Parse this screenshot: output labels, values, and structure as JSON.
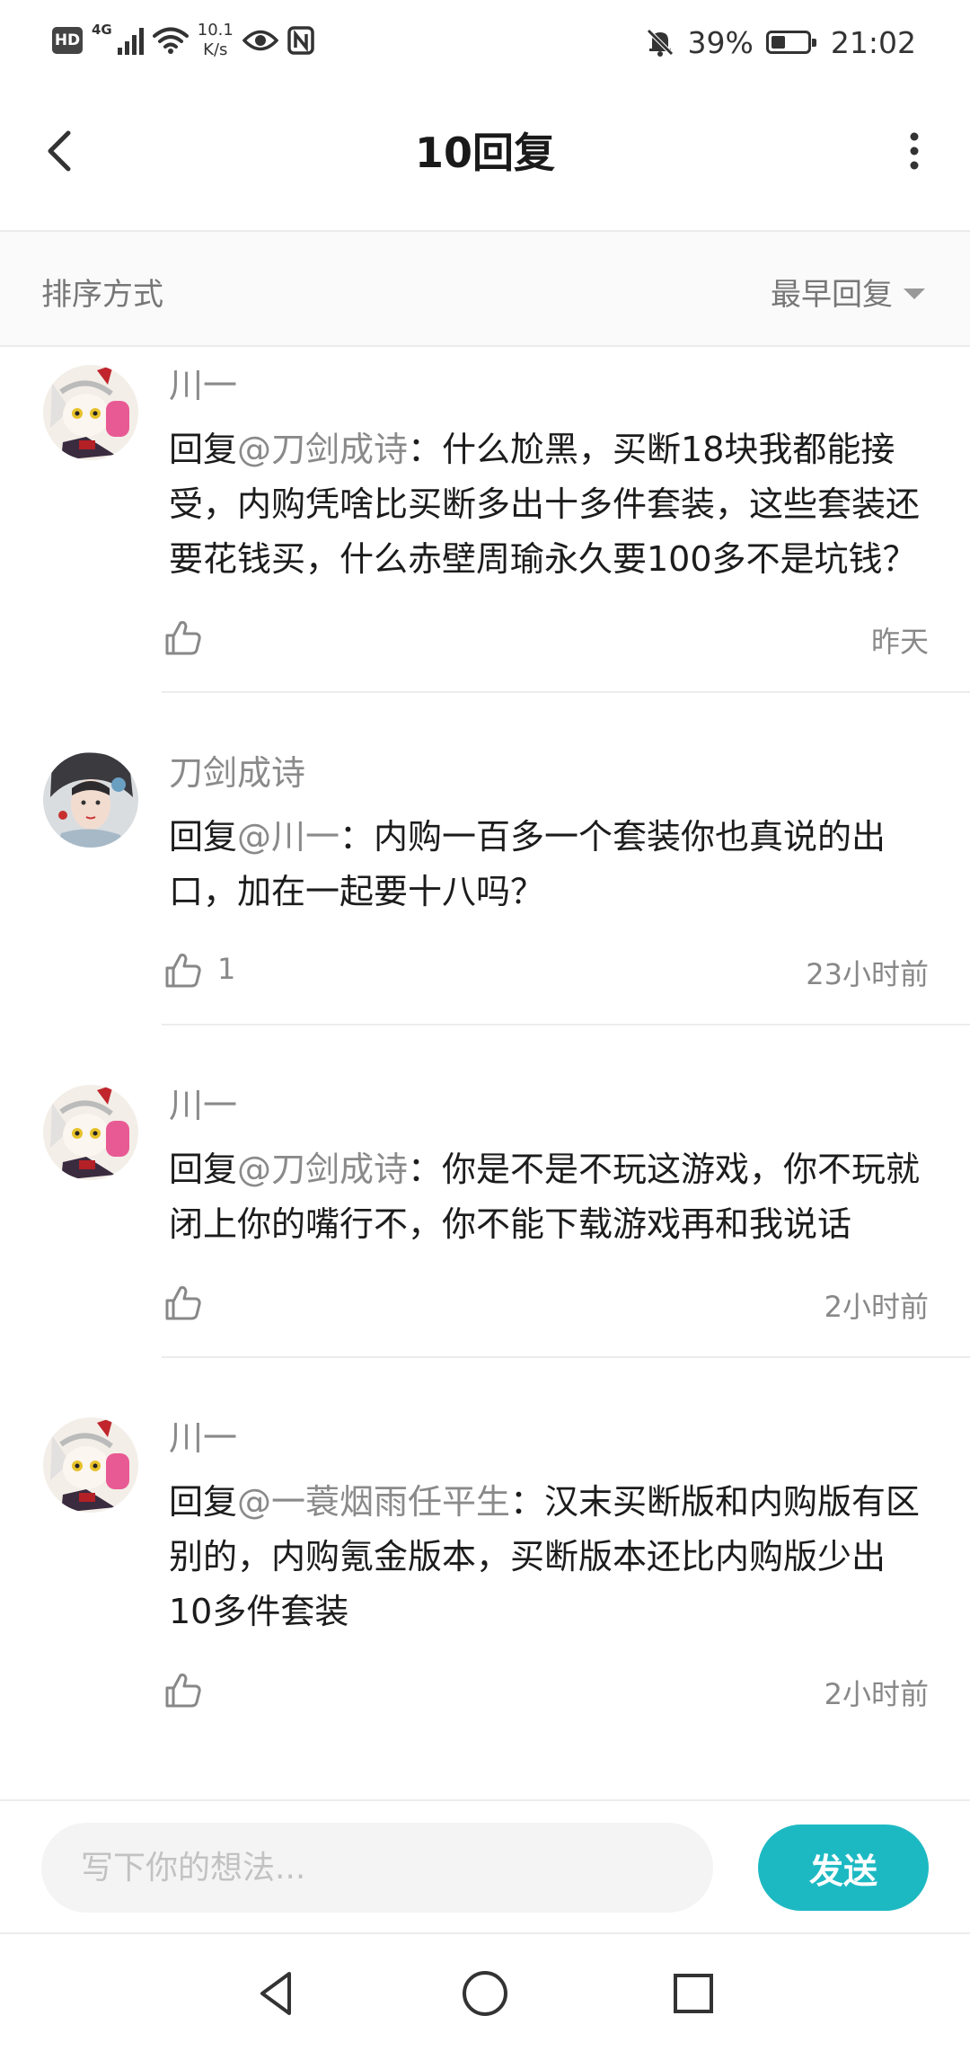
{
  "status_bar": {
    "hd": "HD",
    "network": "4G",
    "speed_value": "10.1",
    "speed_unit": "K/s",
    "battery_text": "39%",
    "battery_level": 0.39,
    "time": "21:02"
  },
  "header": {
    "title": "10回复"
  },
  "sort": {
    "label": "排序方式",
    "selected": "最早回复"
  },
  "comments": [
    {
      "user": "川一",
      "reply_prefix": "回复",
      "mention": "@刀剑成诗",
      "text": "：什么尬黑，买断18块我都能接受，内购凭啥比买断多出十多件套装，这些套装还要花钱买，什么赤壁周瑜永久要100多不是坑钱？",
      "likes": "",
      "time": "昨天"
    },
    {
      "user": "刀剑成诗",
      "reply_prefix": "回复",
      "mention": "@川一",
      "text": "：内购一百多一个套装你也真说的出口，加在一起要十八吗？",
      "likes": "1",
      "time": "23小时前"
    },
    {
      "user": "川一",
      "reply_prefix": "回复",
      "mention": "@刀剑成诗",
      "text": "：你是不是不玩这游戏，你不玩就闭上你的嘴行不，你不能下载游戏再和我说话",
      "likes": "",
      "time": "2小时前"
    },
    {
      "user": "川一",
      "reply_prefix": "回复",
      "mention": "@一蓑烟雨任平生",
      "text": "：汉末买断版和内购版有区别的，内购氪金版本，买断版本还比内购版少出10多件套装",
      "likes": "",
      "time": "2小时前"
    }
  ],
  "input": {
    "placeholder": "写下你的想法..."
  },
  "send_label": "发送",
  "colors": {
    "accent": "#1db9c3",
    "muted_text": "#8a8a8a"
  }
}
